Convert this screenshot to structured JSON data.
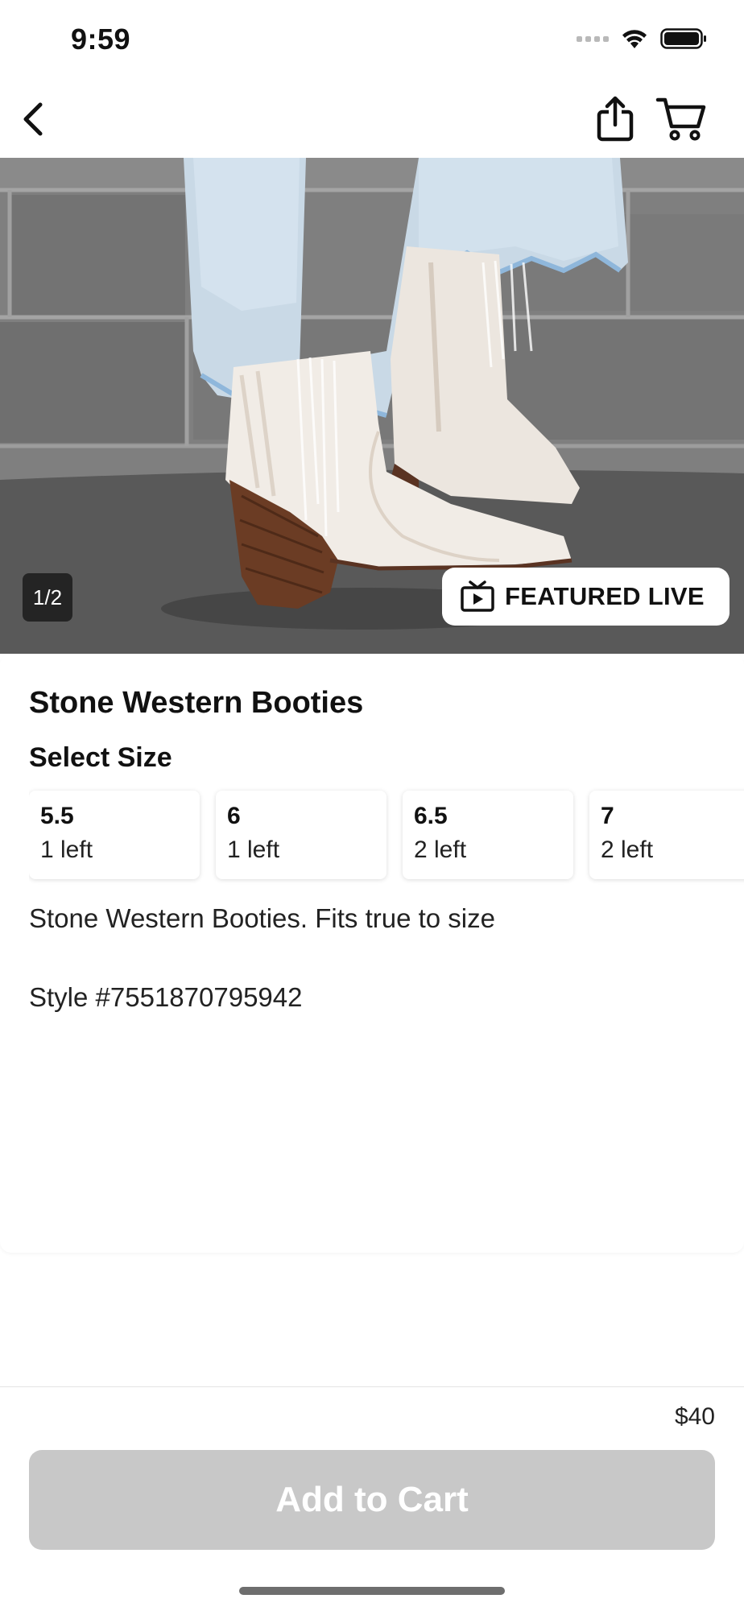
{
  "status_bar": {
    "time": "9:59"
  },
  "nav": {
    "back_icon": "chevron-left-icon",
    "share_icon": "share-icon",
    "cart_icon": "cart-icon"
  },
  "hero": {
    "image_counter": "1/2",
    "featured_badge_label": "FEATURED LIVE",
    "featured_icon": "tv-play-icon"
  },
  "product": {
    "title": "Stone Western Booties",
    "select_size_label": "Select Size",
    "sizes": [
      {
        "size": "5.5",
        "stock": "1 left"
      },
      {
        "size": "6",
        "stock": "1 left"
      },
      {
        "size": "6.5",
        "stock": "2 left"
      },
      {
        "size": "7",
        "stock": "2 left"
      }
    ],
    "description": "Stone Western Booties. Fits true to size",
    "style_number": "Style #7551870795942"
  },
  "checkout": {
    "price": "$40",
    "add_to_cart_label": "Add to Cart",
    "button_color": "#c8c8c8"
  }
}
